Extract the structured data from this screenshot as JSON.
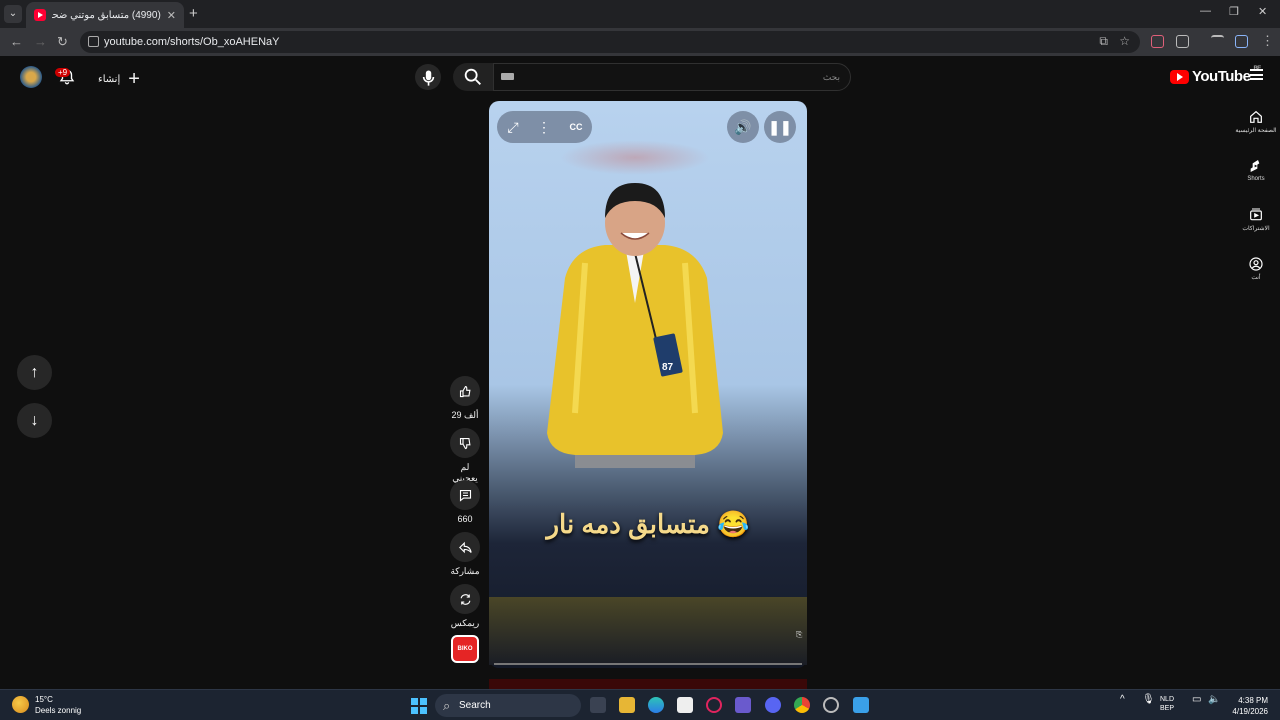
{
  "browser": {
    "tab_title": "(4990) متسابق موتني ضحك",
    "url": "youtube.com/shorts/Ob_xoAHENaY",
    "new_tab_symbol": "+",
    "close_symbol": "✕"
  },
  "youtube": {
    "notification_badge": "+9",
    "create_label": "إنشاء",
    "search_placeholder": "بحث",
    "logo_text": "YouTube",
    "region": "BE",
    "sidebar": [
      {
        "label": "الصفحة الرئيسية",
        "icon": "home-icon"
      },
      {
        "label": "Shorts",
        "icon": "shorts-icon"
      },
      {
        "label": "الاشتراكات",
        "icon": "subscriptions-icon"
      },
      {
        "label": "أنت",
        "icon": "you-icon"
      }
    ]
  },
  "video": {
    "caption": "متسابق دمه نار 😂",
    "badge_number": "87"
  },
  "actions": {
    "likes": "29 ألف",
    "dislike": "لم يعجبني",
    "comments": "660",
    "share": "مشاركة",
    "remix": "ريمكس",
    "sound_label": "BIKO"
  },
  "taskbar": {
    "temperature": "15°C",
    "weather": "Deels zonnig",
    "search": "Search",
    "lang1": "NLD",
    "lang2": "BEP",
    "time": "4:38 PM",
    "date": "4/19/2026"
  },
  "colors": {
    "youtube_red": "#ff0000",
    "caption": "#f5d98a",
    "windows_blue": "#4cc2ff"
  }
}
